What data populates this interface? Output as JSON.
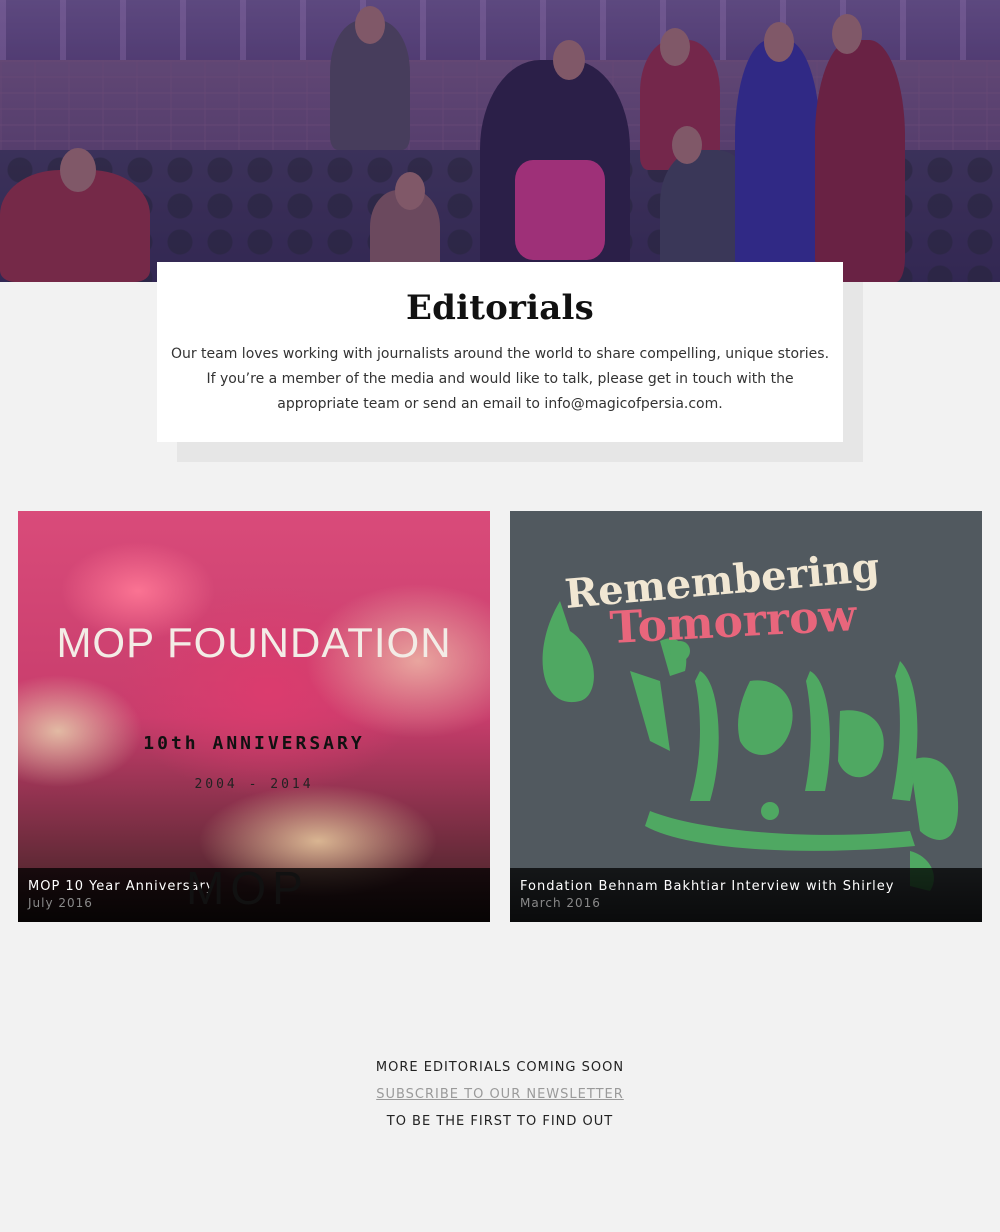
{
  "hero": {
    "image_alt": "Group photo of performers in costumes in front of a brick wall"
  },
  "intro": {
    "title": "Editorials",
    "line1": "Our team loves working with journalists around the world to share compelling, unique stories.",
    "line2": "If you’re a member of the media and would like to talk, please get in touch with the",
    "line3": "appropriate team or send an email to info@magicofpersia.com."
  },
  "editorials": [
    {
      "artwork": {
        "title": "MOP FOUNDATION",
        "subtitle": "10th ANNIVERSARY",
        "years": "2004 - 2014",
        "logo": "MOP"
      },
      "title": "MOP 10 Year Anniversary",
      "date": "July 2016"
    },
    {
      "artwork": {
        "line1": "Remembering",
        "line2": "Tomorrow"
      },
      "title": "Fondation Behnam Bakhtiar Interview with Shirley",
      "date": "March 2016"
    }
  ],
  "coming_soon": {
    "line1": "MORE EDITORIALS COMING SOON",
    "link": "SUBSCRIBE TO OUR NEWSLETTER",
    "line3": "TO BE THE FIRST TO FIND OUT"
  },
  "colors": {
    "background": "#f2f2f2",
    "hero_tint": "#4b3b68",
    "tile2_background": "#51595f",
    "accent_pink": "#e8667c",
    "accent_green": "#4fa862"
  }
}
